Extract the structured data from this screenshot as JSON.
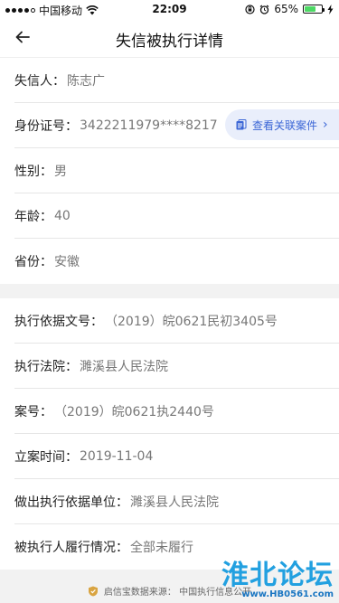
{
  "statusbar": {
    "carrier": "中国移动",
    "time": "22:09",
    "battery_text": "65%",
    "battery_level": 0.65
  },
  "nav": {
    "title": "失信被执行详情"
  },
  "person": {
    "name_label": "失信人：",
    "name_value": "陈志广",
    "id_label": "身份证号：",
    "id_value": "3422211979****8217",
    "related_cases": "查看关联案件",
    "gender_label": "性别：",
    "gender_value": "男",
    "age_label": "年龄：",
    "age_value": "40",
    "province_label": "省份：",
    "province_value": "安徽"
  },
  "case": {
    "basis_no_label": "执行依据文号：",
    "basis_no_value": "（2019）皖0621民初3405号",
    "court_label": "执行法院：",
    "court_value": "濉溪县人民法院",
    "case_no_label": "案号：",
    "case_no_value": "（2019）皖0621执2440号",
    "filing_date_label": "立案时间：",
    "filing_date_value": "2019-11-04",
    "basis_unit_label": "做出执行依据单位：",
    "basis_unit_value": "濉溪县人民法院",
    "performance_label": "被执行人履行情况：",
    "performance_value": "全部未履行"
  },
  "footer": {
    "source": "启信宝数据来源： 中国执行信息公开"
  },
  "watermark": {
    "title": "淮北论坛",
    "url": "www.HB0561.com"
  },
  "colors": {
    "accent": "#3b66d6",
    "battery": "#4cd964"
  }
}
